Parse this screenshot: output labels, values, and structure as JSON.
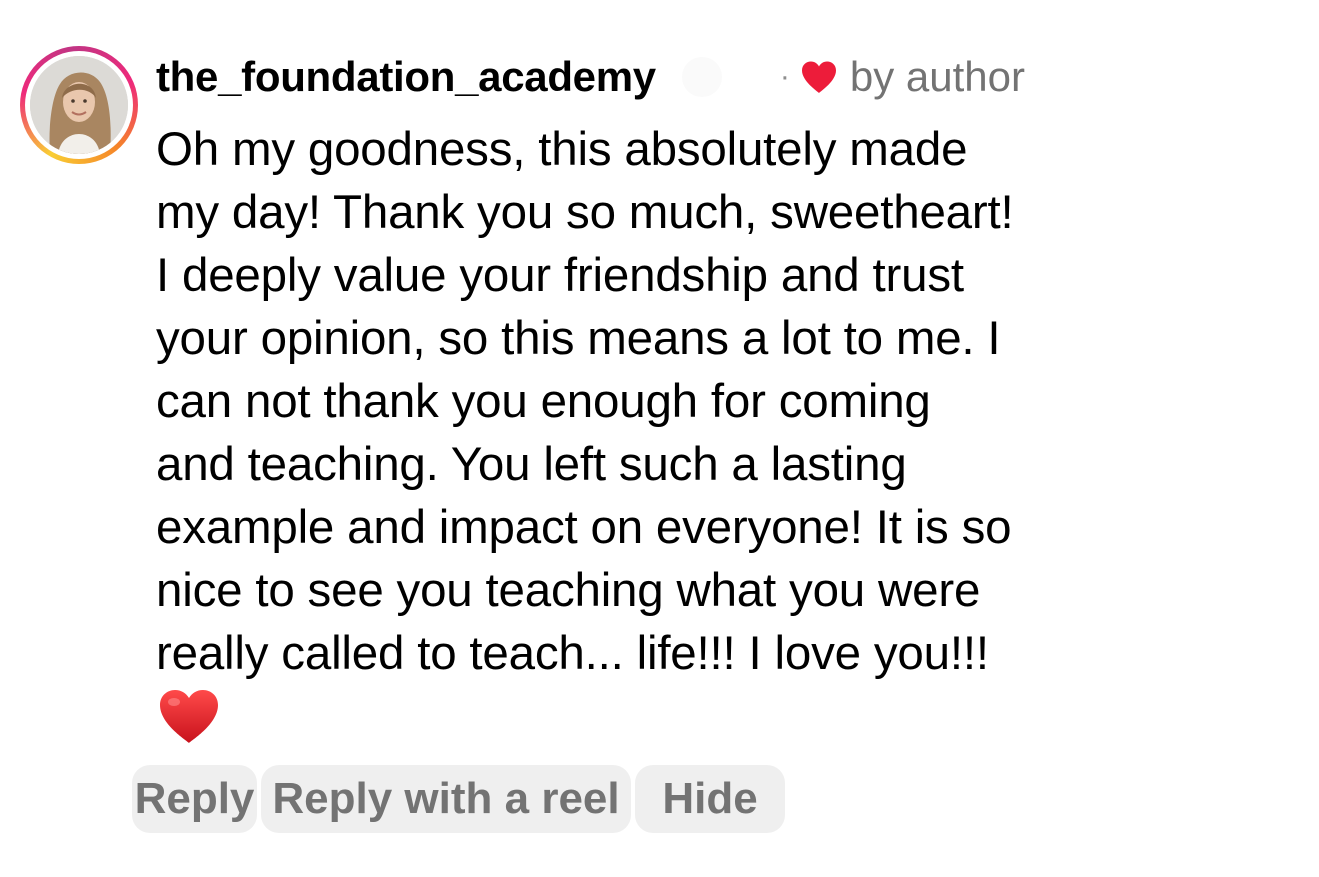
{
  "comment": {
    "username": "the_foundation_academy",
    "separator": "·",
    "liked_by": "by author",
    "text": "Oh my goodness, this absolutely made\nmy day! Thank you so much, sweetheart!\nI deeply value your friendship and trust\nyour opinion, so this means a lot to me. I\ncan not thank you enough for coming\nand teaching. You left such a lasting\nexample and impact on everyone! It is so\nnice to see you teaching what you were\nreally called to teach... life!!! I love you!!!",
    "emoji": "red-heart-emoji"
  },
  "actions": {
    "reply_label": "Reply",
    "reply_reel_label": "Reply with a reel",
    "hide_label": "Hide"
  },
  "colors": {
    "heart": "#ed4956",
    "muted_text": "#737373",
    "pill_bg": "#efefef"
  }
}
